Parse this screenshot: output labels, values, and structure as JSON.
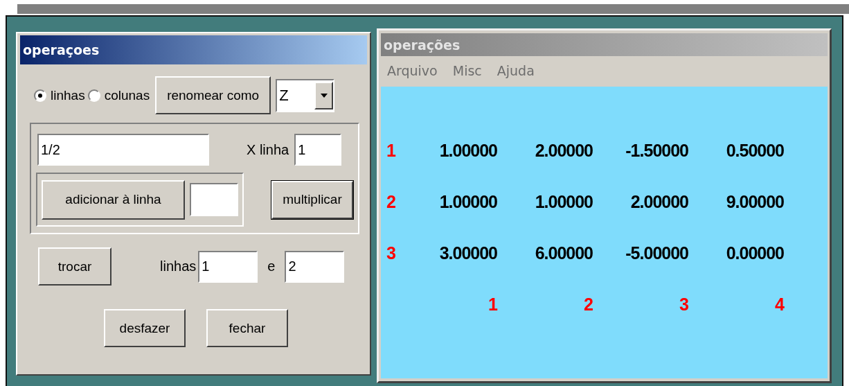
{
  "left_dialog": {
    "title": "operaçoes",
    "active": true,
    "orientation": [
      {
        "label": "linhas",
        "selected": true
      },
      {
        "label": "colunas",
        "selected": false
      }
    ],
    "rename_button": "renomear como",
    "name_select": {
      "value": "Z"
    },
    "factor_field": {
      "value": "1/2"
    },
    "row_label": "X linha",
    "row_field": {
      "value": "1"
    },
    "add_button": "adicionar à linha",
    "multiply_button": {
      "label": "multiplicar",
      "default": true
    },
    "swap_button": "trocar",
    "rows_label": "linhas",
    "swap_from": {
      "value": "1"
    },
    "and_label": "e",
    "swap_to": {
      "value": "2"
    },
    "undo_button": "desfazer",
    "close_button": "fechar"
  },
  "matrix_window": {
    "title": "operações",
    "active": false,
    "menu": [
      "Arquivo",
      "Misc",
      "Ajuda"
    ],
    "rows": [
      {
        "label": "1",
        "values": [
          "1.00000",
          "2.00000",
          "-1.50000",
          "0.50000"
        ]
      },
      {
        "label": "2",
        "values": [
          "1.00000",
          "1.00000",
          "2.00000",
          "9.00000"
        ]
      },
      {
        "label": "3",
        "values": [
          "3.00000",
          "6.00000",
          "-5.00000",
          "0.00000"
        ]
      }
    ],
    "column_labels": [
      "1",
      "2",
      "3",
      "4"
    ]
  }
}
